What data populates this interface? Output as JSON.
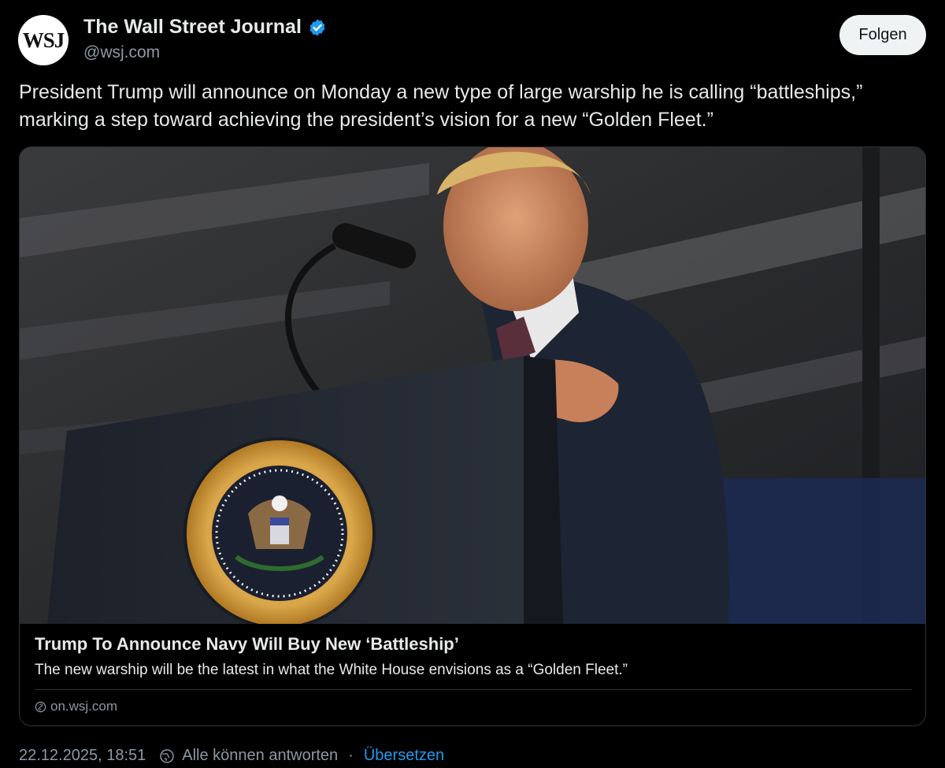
{
  "account": {
    "avatar_text": "WSJ",
    "name": "The Wall Street Journal",
    "handle": "@wsj.com",
    "verified_icon": "verified-badge-icon",
    "follow_label": "Folgen"
  },
  "post": {
    "text": "President Trump will announce on Monday a new type of large warship he is calling “battleships,” marking a step toward achieving the president’s vision for a new “Golden Fleet.”"
  },
  "card": {
    "image_alt": "Trump speaking at podium with presidential seal",
    "seal_text": "SEAL OF THE PRESIDENT OF THE UNITED STATES",
    "title": "Trump To Announce Navy Will Buy New ‘Battleship’",
    "description": "The new warship will be the latest in what the White House envisions as a “Golden Fleet.”",
    "domain": "on.wsj.com",
    "domain_icon": "link-icon"
  },
  "footer": {
    "timestamp": "22.12.2025, 18:51",
    "reply_setting_icon": "globe-icon",
    "reply_setting": "Alle können antworten",
    "separator": "·",
    "translate_label": "Übersetzen"
  },
  "colors": {
    "background": "#000000",
    "text": "#e7e9ea",
    "muted": "#8b98a5",
    "accent": "#1d9bf0",
    "border": "#2f3336"
  }
}
